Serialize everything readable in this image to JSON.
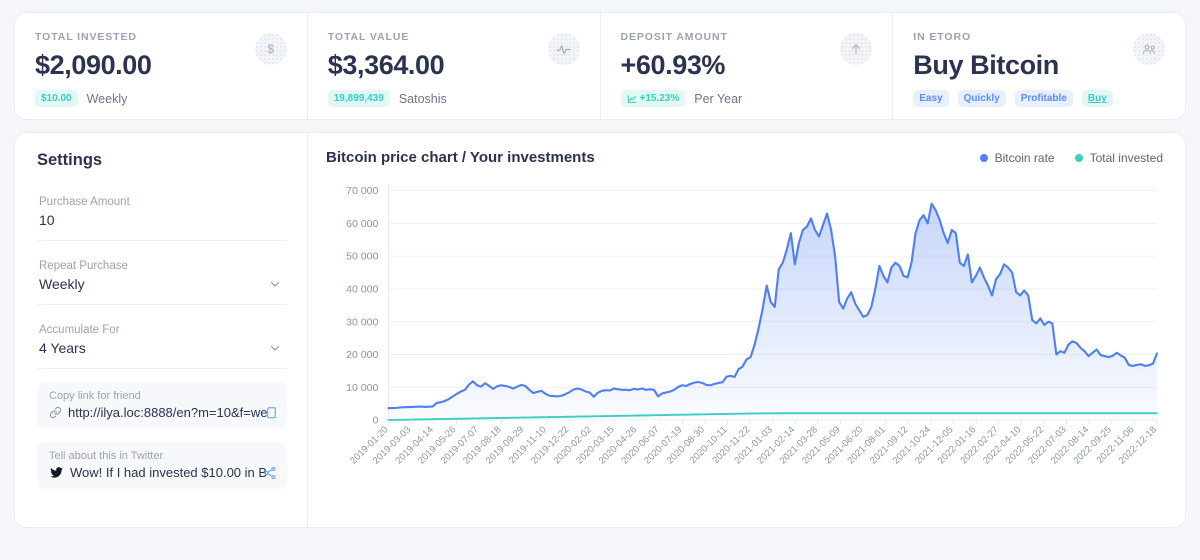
{
  "stats": [
    {
      "label": "TOTAL INVESTED",
      "value": "$2,090.00",
      "chip": "$10.00",
      "chip_style": "teal",
      "sub": "Weekly",
      "icon": "dollar-icon",
      "icon_glyph": "$"
    },
    {
      "label": "TOTAL VALUE",
      "value": "$3,364.00",
      "chip": "19,899,439",
      "chip_style": "teal",
      "sub": "Satoshis",
      "icon": "pulse-icon",
      "icon_glyph": "pulse"
    },
    {
      "label": "DEPOSIT AMOUNT",
      "value": "+60.93%",
      "chip": "+15.23%",
      "chip_style": "teal",
      "sub": "Per Year",
      "icon": "arrow-up-icon",
      "icon_glyph": "↑"
    },
    {
      "label": "IN ETORO",
      "value": "Buy Bitcoin",
      "badges": [
        "Easy",
        "Quickly",
        "Profitable"
      ],
      "link_badge": "Buy",
      "icon": "people-icon",
      "icon_glyph": "people"
    }
  ],
  "settings": {
    "title": "Settings",
    "purchase_amount": {
      "label": "Purchase Amount",
      "value": "10"
    },
    "repeat_purchase": {
      "label": "Repeat Purchase",
      "value": "Weekly"
    },
    "accumulate_for": {
      "label": "Accumulate For",
      "value": "4 Years"
    },
    "copy_link": {
      "label": "Copy link for friend",
      "value": "http://ilya.loc:8888/en?m=10&f=we"
    },
    "twitter": {
      "label": "Tell about this in Twitter",
      "value": "Wow! If I had invested $10.00 in B"
    }
  },
  "colors": {
    "bitcoin_rate": "#4f7ff0",
    "total_invested": "#3ccfc0",
    "accent_blue": "#5b8cf8",
    "accent_teal": "#35cfc2",
    "text_dark": "#2b3350",
    "text_muted": "#9aa3b4"
  },
  "chart_data": {
    "type": "area",
    "title": "Bitcoin price chart / Your investments",
    "xlabel": "",
    "ylabel": "",
    "ylim": [
      0,
      72000
    ],
    "yticks": [
      0,
      10000,
      20000,
      30000,
      40000,
      50000,
      60000,
      70000
    ],
    "ytick_labels": [
      "0",
      "10 000",
      "20 000",
      "30 000",
      "40 000",
      "50 000",
      "60 000",
      "70 000"
    ],
    "grid": true,
    "legend_position": "top-right",
    "legend": [
      {
        "name": "Bitcoin rate",
        "color": "#4f7ff0"
      },
      {
        "name": "Total invested",
        "color": "#3ccfc0"
      }
    ],
    "xtick_labels": [
      "2019-01-20",
      "2019-03-03",
      "2019-04-14",
      "2019-05-26",
      "2019-07-07",
      "2019-08-18",
      "2019-09-29",
      "2019-11-10",
      "2019-12-22",
      "2020-02-02",
      "2020-03-15",
      "2020-04-26",
      "2020-06-07",
      "2020-07-19",
      "2020-08-30",
      "2020-10-11",
      "2020-11-22",
      "2021-01-03",
      "2021-02-14",
      "2021-03-28",
      "2021-05-09",
      "2021-06-20",
      "2021-08-01",
      "2021-09-12",
      "2021-10-24",
      "2021-12-05",
      "2022-01-16",
      "2022-02-27",
      "2022-04-10",
      "2022-05-22",
      "2022-07-03",
      "2022-08-14",
      "2022-09-25",
      "2022-11-06",
      "2022-12-18"
    ],
    "series": [
      {
        "name": "Bitcoin rate",
        "color": "#4f7ff0",
        "filled": true,
        "values": [
          3600,
          3650,
          3700,
          3850,
          3900,
          3950,
          4000,
          4050,
          4100,
          3980,
          4050,
          4150,
          5200,
          5400,
          5800,
          6400,
          7200,
          8000,
          8700,
          9200,
          10800,
          11800,
          10600,
          10200,
          11200,
          10400,
          9500,
          10300,
          10600,
          10400,
          10100,
          9600,
          10200,
          10700,
          10400,
          9200,
          8200,
          8600,
          8900,
          8000,
          7400,
          7300,
          7200,
          7400,
          7900,
          8500,
          9300,
          9600,
          9300,
          8700,
          8400,
          7100,
          8300,
          8900,
          9100,
          9000,
          9600,
          9400,
          9200,
          9200,
          9100,
          9500,
          9300,
          9600,
          9200,
          9350,
          9200,
          7200,
          8100,
          8400,
          8700,
          9200,
          10100,
          10600,
          10400,
          11000,
          11400,
          11600,
          11300,
          10700,
          10600,
          11000,
          11300,
          11500,
          13200,
          13500,
          13100,
          15500,
          16300,
          18500,
          19200,
          23000,
          28000,
          34000,
          41000,
          36000,
          34500,
          46000,
          48000,
          52000,
          57000,
          47500,
          54000,
          58000,
          59000,
          61500,
          58000,
          56000,
          59500,
          63000,
          58000,
          50000,
          36000,
          34000,
          37000,
          39000,
          35500,
          33500,
          31500,
          32000,
          34500,
          40000,
          47000,
          44000,
          42000,
          46500,
          48000,
          47000,
          44000,
          43500,
          48000,
          57000,
          61000,
          62500,
          60000,
          66000,
          64000,
          61000,
          57000,
          54000,
          58000,
          57000,
          48000,
          47000,
          50500,
          42000,
          44000,
          46500,
          43500,
          41000,
          38000,
          43000,
          44500,
          47500,
          46500,
          45000,
          39000,
          38000,
          39500,
          38000,
          30500,
          29500,
          31000,
          29000,
          30000,
          29500,
          20000,
          21000,
          20500,
          23000,
          24000,
          23500,
          22000,
          21000,
          19500,
          20500,
          21500,
          19800,
          19500,
          19200,
          19600,
          20500,
          19700,
          19000,
          16800,
          16500,
          16800,
          17000,
          16500,
          16700,
          17200,
          20300
        ]
      },
      {
        "name": "Total invested",
        "color": "#3ccfc0",
        "filled": false,
        "values": [
          10,
          30,
          50,
          70,
          90,
          110,
          140,
          160,
          180,
          200,
          220,
          250,
          270,
          290,
          310,
          330,
          360,
          380,
          400,
          420,
          440,
          470,
          490,
          510,
          530,
          550,
          580,
          600,
          620,
          640,
          660,
          690,
          710,
          730,
          750,
          770,
          800,
          820,
          840,
          860,
          880,
          910,
          930,
          950,
          970,
          990,
          1020,
          1040,
          1060,
          1080,
          1100,
          1130,
          1150,
          1170,
          1190,
          1210,
          1240,
          1260,
          1280,
          1300,
          1320,
          1350,
          1370,
          1390,
          1410,
          1430,
          1460,
          1480,
          1500,
          1520,
          1540,
          1570,
          1590,
          1610,
          1630,
          1650,
          1680,
          1700,
          1720,
          1740,
          1760,
          1790,
          1810,
          1830,
          1850,
          1870,
          1900,
          1920,
          1940,
          1960,
          1980,
          2000,
          2010,
          2020,
          2030,
          2040,
          2050,
          2055,
          2060,
          2065,
          2070,
          2072,
          2074,
          2076,
          2078,
          2080,
          2081,
          2082,
          2083,
          2084,
          2085,
          2085,
          2086,
          2086,
          2086,
          2087,
          2087,
          2087,
          2088,
          2088,
          2088,
          2088,
          2088,
          2088,
          2089,
          2089,
          2089,
          2089,
          2089,
          2089,
          2089,
          2089,
          2089,
          2089,
          2089,
          2090,
          2090,
          2090,
          2090,
          2090,
          2090,
          2090,
          2090,
          2090,
          2090,
          2090,
          2090,
          2090,
          2090,
          2090,
          2090,
          2090,
          2090,
          2090,
          2090,
          2090,
          2090,
          2090,
          2090,
          2090,
          2090,
          2090,
          2090,
          2090,
          2090,
          2090,
          2090,
          2090,
          2090,
          2090,
          2090,
          2090,
          2090,
          2090,
          2090,
          2090,
          2090,
          2090,
          2090,
          2090,
          2090,
          2090,
          2090,
          2090,
          2090,
          2090,
          2090,
          2090,
          2090,
          2090,
          2090,
          2090
        ]
      }
    ]
  }
}
